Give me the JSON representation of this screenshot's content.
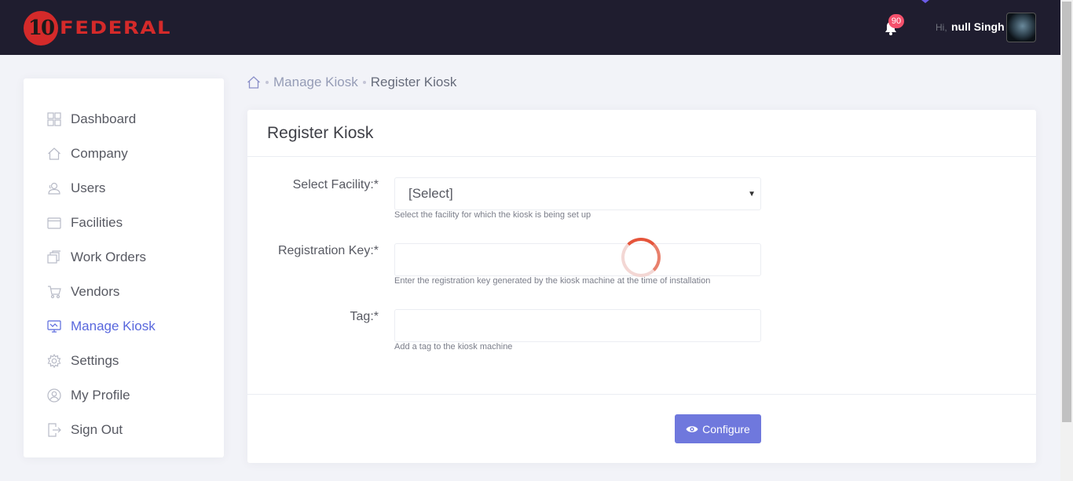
{
  "header": {
    "logo": {
      "number": "10",
      "brand": "FEDERAL"
    },
    "notifications_count": "90",
    "greeting": "Hi,",
    "user_name": "null Singh"
  },
  "sidebar": {
    "items": [
      {
        "label": "Dashboard",
        "icon": "dashboard-icon"
      },
      {
        "label": "Company",
        "icon": "home-icon"
      },
      {
        "label": "Users",
        "icon": "users-icon"
      },
      {
        "label": "Facilities",
        "icon": "facilities-icon"
      },
      {
        "label": "Work Orders",
        "icon": "work-orders-icon"
      },
      {
        "label": "Vendors",
        "icon": "cart-icon"
      },
      {
        "label": "Manage Kiosk",
        "icon": "kiosk-icon",
        "active": true
      },
      {
        "label": "Settings",
        "icon": "gear-icon"
      },
      {
        "label": "My Profile",
        "icon": "profile-icon"
      },
      {
        "label": "Sign Out",
        "icon": "sign-out-icon"
      }
    ]
  },
  "breadcrumb": {
    "home_icon": "home-icon",
    "items": [
      "Manage Kiosk",
      "Register Kiosk"
    ]
  },
  "form": {
    "title": "Register Kiosk",
    "facility": {
      "label": "Select Facility:*",
      "value": "[Select]",
      "help": "Select the facility for which the kiosk is being set up"
    },
    "registration_key": {
      "label": "Registration Key:*",
      "value": "",
      "help": "Enter the registration key generated by the kiosk machine at the time of installation"
    },
    "tag": {
      "label": "Tag:*",
      "value": "",
      "help": "Add a tag to the kiosk machine"
    },
    "configure_button": {
      "label": "Configure",
      "icon": "eye-icon"
    }
  },
  "colors": {
    "topbar": "#1f1d2f",
    "brand_red": "#d42a2a",
    "accent": "#5867dd",
    "button": "#6f78dd",
    "badge": "#f4516c"
  }
}
